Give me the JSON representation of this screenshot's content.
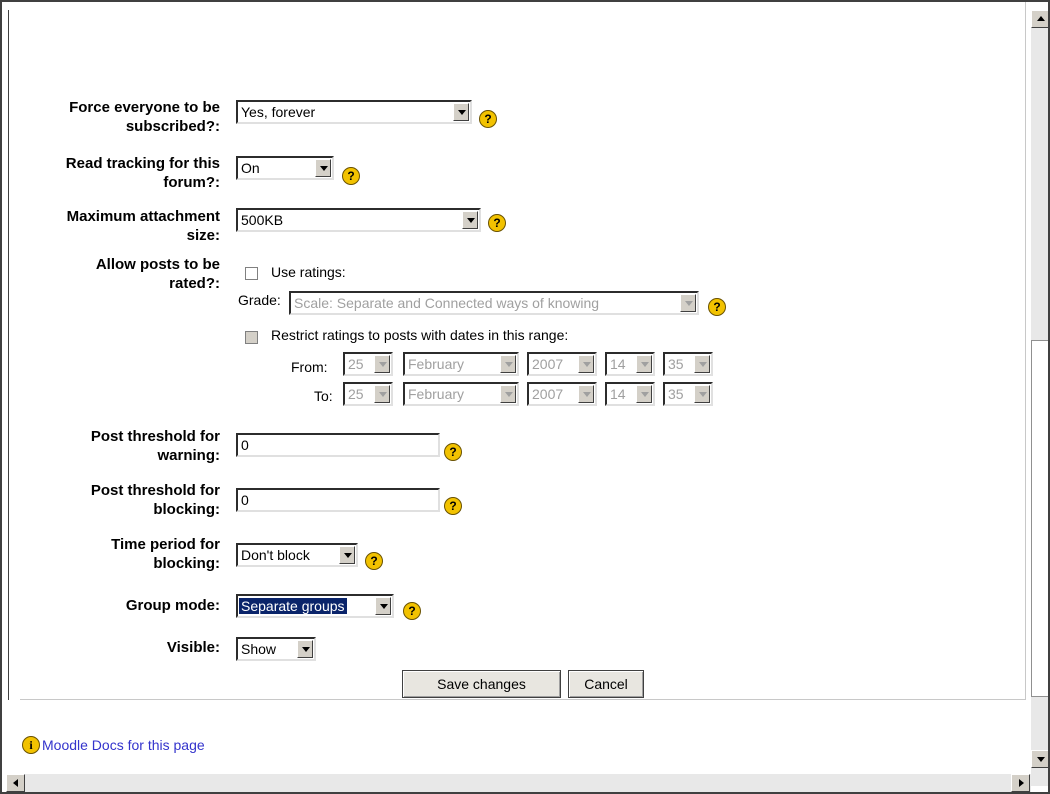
{
  "form": {
    "subscribe": {
      "label_line1": "Force everyone to be",
      "label_line2": "subscribed?:",
      "value": "Yes, forever"
    },
    "tracking": {
      "label_line1": "Read tracking for this",
      "label_line2": "forum?:",
      "value": "On"
    },
    "attachment": {
      "label_line1": "Maximum attachment",
      "label_line2": "size:",
      "value": "500KB"
    },
    "ratings": {
      "label_line1": "Allow posts to be",
      "label_line2": "rated?:",
      "use_ratings_label": "Use ratings:",
      "use_ratings_checked": false,
      "grade_label": "Grade:",
      "grade_value": "Scale: Separate and Connected ways of knowing",
      "restrict_label": "Restrict ratings to posts with dates in this range:",
      "restrict_checked": false,
      "from": {
        "label": "From:",
        "day": "25",
        "month": "February",
        "year": "2007",
        "hour": "14",
        "minute": "35"
      },
      "to": {
        "label": "To:",
        "day": "25",
        "month": "February",
        "year": "2007",
        "hour": "14",
        "minute": "35"
      }
    },
    "warning": {
      "label_line1": "Post threshold for",
      "label_line2": "warning:",
      "value": "0"
    },
    "blocking": {
      "label_line1": "Post threshold for",
      "label_line2": "blocking:",
      "value": "0"
    },
    "block_period": {
      "label_line1": "Time period for",
      "label_line2": "blocking:",
      "value": "Don't block"
    },
    "group_mode": {
      "label": "Group mode:",
      "value": "Separate groups"
    },
    "visible": {
      "label": "Visible:",
      "value": "Show"
    },
    "help_glyph": "?",
    "save_label": "Save changes",
    "cancel_label": "Cancel"
  },
  "footer": {
    "docs_link": "Moodle Docs for this page",
    "info_glyph": "i"
  },
  "colors": {
    "help_icon": "#f2c200",
    "link": "#3333cc",
    "selection": "#0a246a"
  }
}
